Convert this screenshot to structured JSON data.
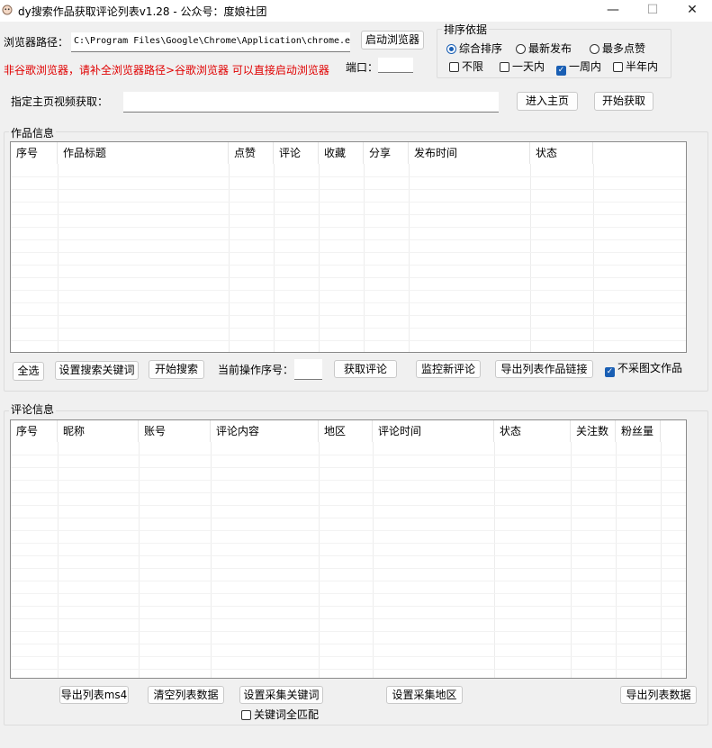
{
  "window": {
    "title": "dy搜索作品获取评论列表v1.28 - 公众号：度娘社团",
    "minimize_glyph": "—",
    "maximize_glyph": "☐",
    "close_glyph": "✕"
  },
  "browser": {
    "path_label": "浏览器路径：",
    "path_value": "C:\\Program Files\\Google\\Chrome\\Application\\chrome.e",
    "launch_button": "启动浏览器",
    "warning": "非谷歌浏览器，请补全浏览器路径>谷歌浏览器 可以直接启动浏览器",
    "port_label": "端口：",
    "port_value": ""
  },
  "sort": {
    "title": "排序依据",
    "options": [
      {
        "label": "综合排序",
        "selected": true
      },
      {
        "label": "最新发布",
        "selected": false
      },
      {
        "label": "最多点赞",
        "selected": false
      }
    ],
    "time_filters": [
      {
        "label": "不限",
        "checked": false
      },
      {
        "label": "一天内",
        "checked": false
      },
      {
        "label": "一周内",
        "checked": true
      },
      {
        "label": "半年内",
        "checked": false
      }
    ]
  },
  "homepage": {
    "label": "指定主页视频获取：",
    "value": "",
    "enter_button": "进入主页",
    "start_button": "开始获取"
  },
  "works": {
    "group_title": "作品信息",
    "columns": [
      "序号",
      "作品标题",
      "点赞",
      "评论",
      "收藏",
      "分享",
      "发布时间",
      "状态"
    ],
    "select_all": "全选",
    "set_keywords": "设置搜索关键词",
    "start_search": "开始搜索",
    "current_index_label": "当前操作序号：",
    "current_index_value": "",
    "get_comments": "获取评论",
    "monitor_comments": "监控新评论",
    "export_links": "导出列表作品链接",
    "skip_image_posts": {
      "label": "不采图文作品",
      "checked": true
    }
  },
  "comments": {
    "group_title": "评论信息",
    "columns": [
      "序号",
      "昵称",
      "账号",
      "评论内容",
      "地区",
      "评论时间",
      "状态",
      "关注数",
      "粉丝量"
    ],
    "export_ms4": "导出列表ms4",
    "clear_list": "清空列表数据",
    "set_collect_keywords": "设置采集关键词",
    "set_collect_region": "设置采集地区",
    "export_list": "导出列表数据",
    "keyword_full_match": {
      "label": "关键词全匹配",
      "checked": false
    }
  }
}
